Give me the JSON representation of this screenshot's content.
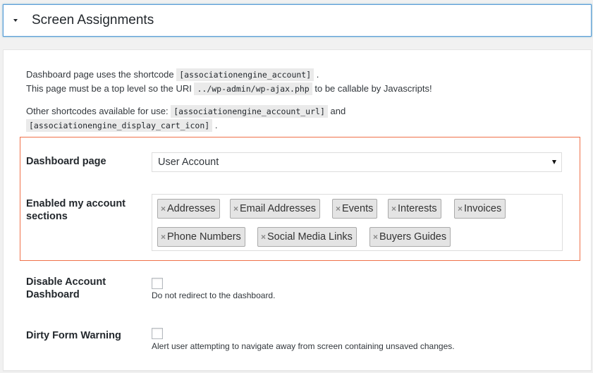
{
  "accordion": {
    "title": "Screen Assignments"
  },
  "description": {
    "line1_pre": "Dashboard page uses the shortcode",
    "line1_code": "[associationengine_account]",
    "line1_post": ".",
    "line2_pre": "This page must be a top level so the URI",
    "line2_code": "../wp-admin/wp-ajax.php",
    "line2_post": "to be callable by Javascripts!",
    "line3_pre": "Other shortcodes available for use:",
    "line3_code1": "[associationengine_account_url]",
    "line3_mid": "and",
    "line3_code2": "[associationengine_display_cart_icon]",
    "line3_post": "."
  },
  "dashboard_page": {
    "label": "Dashboard page",
    "value": "User Account"
  },
  "sections": {
    "label_line1": "Enabled my account",
    "label_line2": "sections",
    "remove_glyph": "×",
    "tags": [
      "Addresses",
      "Email Addresses",
      "Events",
      "Interests",
      "Invoices",
      "Phone Numbers",
      "Social Media Links",
      "Buyers Guides"
    ]
  },
  "disable_dashboard": {
    "label_line1": "Disable Account",
    "label_line2": "Dashboard",
    "help": "Do not redirect to the dashboard."
  },
  "dirty_form": {
    "label": "Dirty Form Warning",
    "help": "Alert user attempting to navigate away from screen containing unsaved changes."
  }
}
